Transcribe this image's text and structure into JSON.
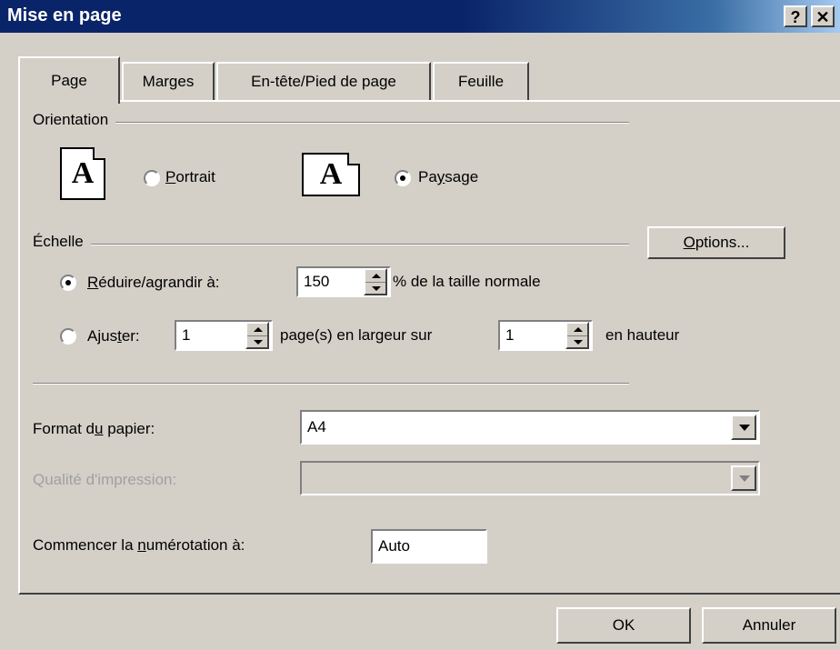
{
  "window": {
    "title": "Mise en page",
    "help_glyph": "?",
    "close_glyph": "✕"
  },
  "tabs": [
    {
      "label": "Page",
      "active": true
    },
    {
      "label": "Marges",
      "active": false
    },
    {
      "label": "En-tête/Pied de page",
      "active": false
    },
    {
      "label": "Feuille",
      "active": false
    }
  ],
  "orientation": {
    "group_label": "Orientation",
    "portrait": {
      "prefix": "",
      "accel": "P",
      "rest": "ortrait",
      "selected": false,
      "icon": "portrait-page-icon",
      "glyph": "A"
    },
    "paysage": {
      "prefix": "Pa",
      "accel": "y",
      "rest": "sage",
      "selected": true,
      "icon": "landscape-page-icon",
      "glyph": "A"
    }
  },
  "echelle": {
    "group_label": "Échelle",
    "options_button": {
      "accel": "O",
      "rest": "ptions..."
    },
    "reduire": {
      "accel": "R",
      "rest": "éduire/agrandir à:",
      "value": "150",
      "suffix": "% de la taille normale",
      "selected": true
    },
    "ajuster": {
      "prefix": "Ajus",
      "accel": "t",
      "rest": "er:",
      "width_value": "1",
      "middle": "page(s) en largeur sur",
      "height_value": "1",
      "suffix": "en hauteur",
      "selected": false
    }
  },
  "paper": {
    "prefix": "Format d",
    "accel": "u",
    "rest": " papier:",
    "value": "A4"
  },
  "quality": {
    "label": "Qualité d'impression:",
    "value": "",
    "disabled": true
  },
  "numbering": {
    "prefix": "Commencer la ",
    "accel": "n",
    "rest": "umérotation à:",
    "value": "Auto"
  },
  "buttons": {
    "ok": "OK",
    "cancel": "Annuler"
  },
  "colors": {
    "titlebar": "#0a246a",
    "face": "#d4d0c8",
    "disabled_text": "#a0a0a0"
  }
}
